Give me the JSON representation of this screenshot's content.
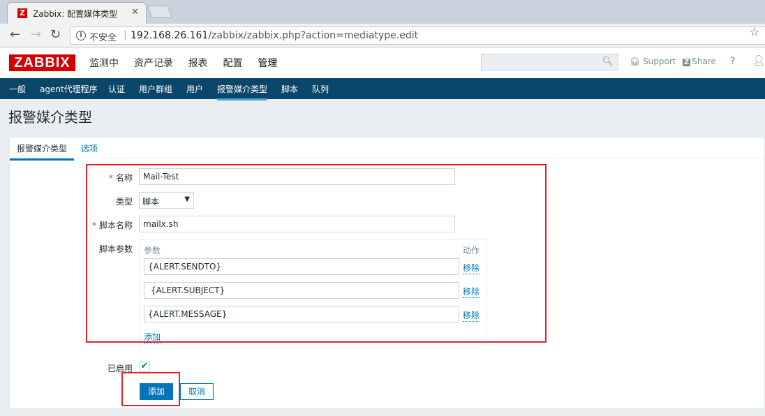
{
  "browser": {
    "tab_title": "Zabbix: 配置媒体类型",
    "tab_favicon": "Z",
    "security_label": "不安全",
    "url_host": "192.168.26.161",
    "url_path": "/zabbix/zabbix.php?action=mediatype.edit"
  },
  "header": {
    "logo": "ZABBIX",
    "menu": [
      "监测中",
      "资产记录",
      "报表",
      "配置",
      "管理"
    ],
    "active_menu": "管理",
    "support": "Support",
    "share": "Share",
    "help": "?"
  },
  "submenu": {
    "items": [
      "一般",
      "agent代理程序",
      "认证",
      "用户群组",
      "用户",
      "报警媒介类型",
      "脚本",
      "队列"
    ],
    "active": "报警媒介类型"
  },
  "page": {
    "title": "报警媒介类型"
  },
  "form": {
    "tabs": [
      "报警媒介类型",
      "选项"
    ],
    "name_label": "名称",
    "name_value": "Mail-Test",
    "type_label": "类型",
    "type_value": "脚本",
    "script_name_label": "脚本名称",
    "script_name_value": "mailx.sh",
    "params_label": "脚本参数",
    "params_header_param": "参数",
    "params_header_action": "动作",
    "params": [
      {
        "value": "{ALERT.SENDTO}",
        "remove": "移除"
      },
      {
        "value": " {ALERT.SUBJECT}",
        "remove": "移除"
      },
      {
        "value": "{ALERT.MESSAGE}",
        "remove": "移除"
      }
    ],
    "add_param": "添加",
    "enabled_label": "已启用",
    "enabled": true,
    "submit": "添加",
    "cancel": "取消"
  },
  "colors": {
    "brand_red": "#d40000",
    "submenu_bg": "#0a466a",
    "link_blue": "#0275b8",
    "annotation_red": "#e0232b"
  }
}
